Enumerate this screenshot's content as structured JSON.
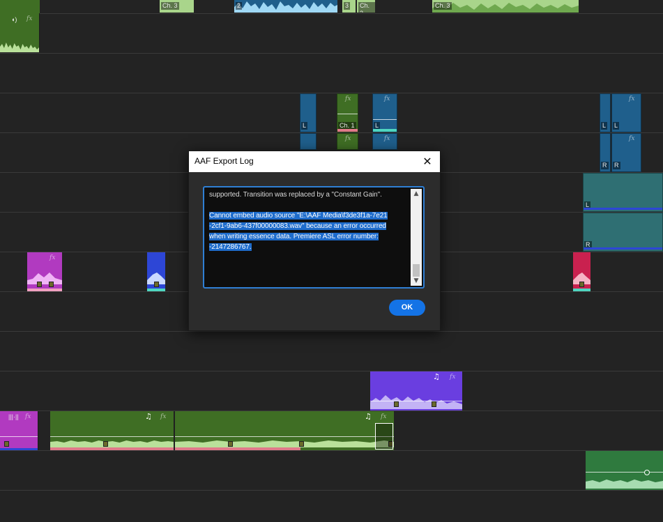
{
  "timeline": {
    "clip_labels": {
      "ch3_a": "Ch. 3",
      "two": "2",
      "three": "3",
      "ch3_b": "Ch. 3",
      "ch3_c": "Ch. 3",
      "ch1": "Ch. 1",
      "left": "L",
      "right": "R"
    },
    "fx_label": "fx",
    "music_icon": "music-note-icon",
    "colors": {
      "green": "#3f6e24",
      "light_green": "#a9d58b",
      "blue": "#1f5f8c",
      "light_blue": "#9fd8f5",
      "teal": "#2f6f73",
      "magenta": "#b13ac0",
      "violet": "#6a3ee0",
      "crimson": "#c9214f",
      "royal_blue": "#2d46d6"
    }
  },
  "dialog": {
    "title": "AAF Export Log",
    "close_icon": "close-icon",
    "log_line_1": "supported. Transition was replaced by a \"Constant Gain\".",
    "log_selected_1": "Cannot embed audio source \"E:\\AAF Media\\f3de3f1a-7e21",
    "log_selected_2": "-2cf1-9ab6-437f00000083.wav\" because an error occurred",
    "log_selected_3": "when writing essence data. Premiere ASL error number:",
    "log_selected_4": "-2147286767.",
    "ok_label": "OK"
  }
}
